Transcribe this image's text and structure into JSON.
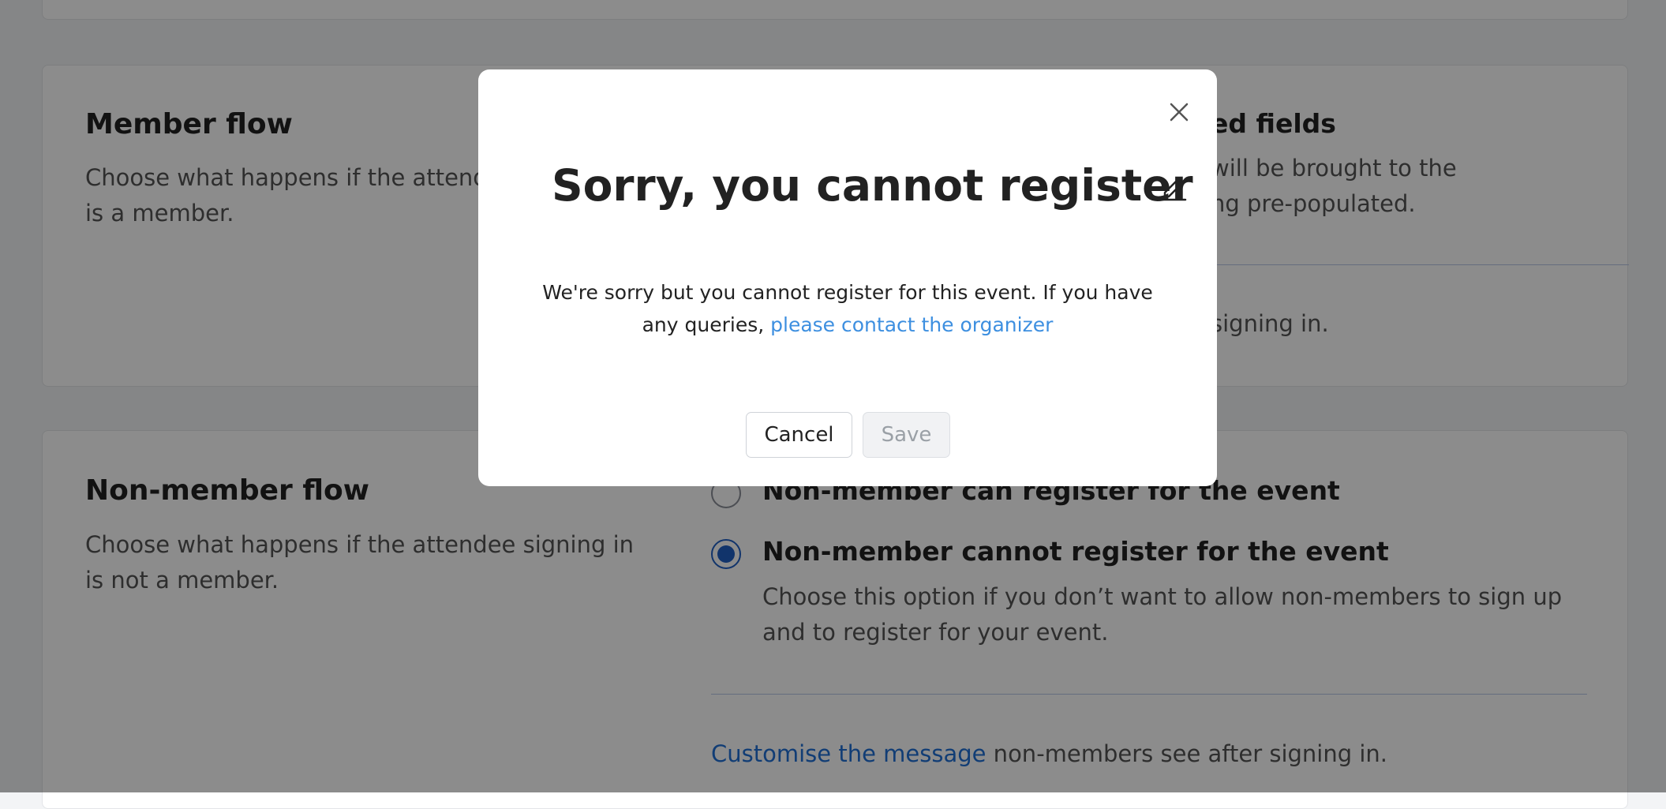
{
  "member_flow": {
    "title": "Member flow",
    "description": "Choose what happens if the attendee signing in is a member.",
    "right_title_fragment": "ed fields",
    "right_desc_line1": "will be brought to the",
    "right_desc_line2": "ng pre-populated.",
    "message_fragment": "signing in."
  },
  "non_member_flow": {
    "title": "Non-member flow",
    "description": "Choose what happens if the attendee signing in is not a member.",
    "options": [
      {
        "label": "Non-member can register for the event",
        "selected": false
      },
      {
        "label": "Non-member cannot register for the event",
        "selected": true,
        "description": "Choose this option if you don’t want to allow non-members to sign up and to register for your event."
      }
    ],
    "customise_link": "Customise the message",
    "customise_suffix": " non-members see after signing in."
  },
  "modal": {
    "title": "Sorry, you cannot register",
    "body_text": "We're sorry but you cannot register for this event. If you have any queries, ",
    "body_link": "please contact the organizer",
    "cancel_label": "Cancel",
    "save_label": "Save"
  },
  "icons": {
    "close": "close-icon",
    "edit": "pencil-icon"
  },
  "colors": {
    "accent": "#1f5fc4",
    "link": "#3d8fe0",
    "overlay": "rgba(0,0,0,0.45)"
  }
}
